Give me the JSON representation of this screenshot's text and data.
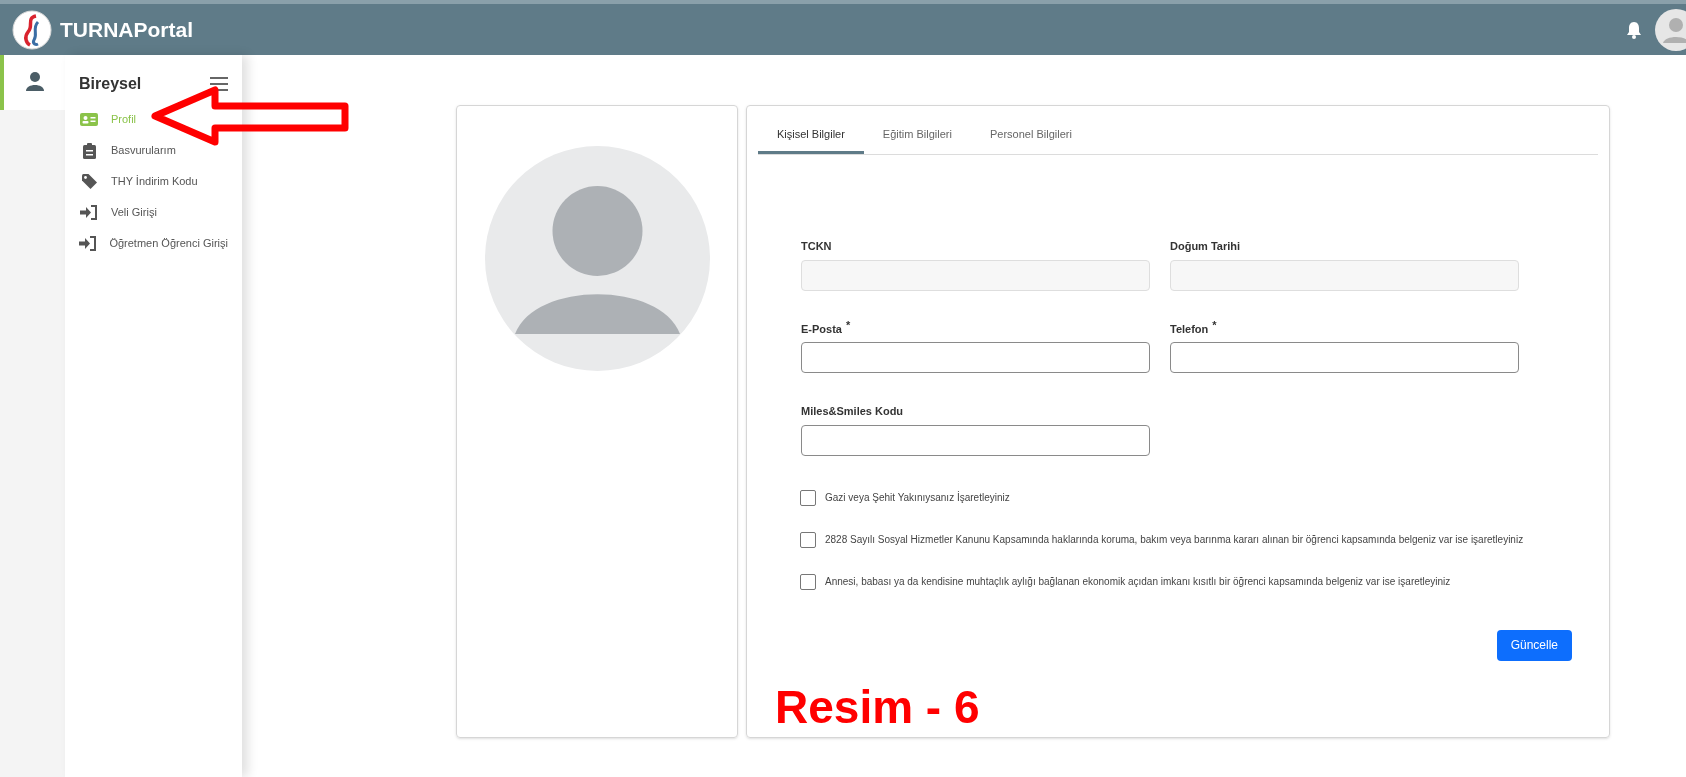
{
  "header": {
    "brand": "TURNAPortal"
  },
  "sidebar": {
    "section": "Bireysel",
    "items": [
      {
        "label": "Profil",
        "kind": "idcard",
        "selected": true
      },
      {
        "label": "Basvurularım",
        "kind": "clipboard",
        "selected": false
      },
      {
        "label": "THY İndirim Kodu",
        "kind": "tag",
        "selected": false
      },
      {
        "label": "Veli Girişi",
        "kind": "login",
        "selected": false
      },
      {
        "label": "Öğretmen Öğrenci Girişi",
        "kind": "login",
        "selected": false
      }
    ]
  },
  "tabs": [
    {
      "label": "Kişisel Bilgiler",
      "selected": true
    },
    {
      "label": "Eğitim Bilgileri",
      "selected": false
    },
    {
      "label": "Personel Bilgileri",
      "selected": false
    }
  ],
  "fields": [
    {
      "label": "TCKN",
      "disabled": true
    },
    {
      "label": "Doğum Tarihi",
      "disabled": true
    },
    {
      "label": "E-Posta",
      "disabled": false,
      "mark": "*"
    },
    {
      "label": "Telefon",
      "disabled": false,
      "mark": "*"
    },
    {
      "label": "Miles&Smiles Kodu",
      "disabled": false
    }
  ],
  "checkboxes": [
    {
      "label": "Gazi veya Şehit Yakınıysanız İşaretleyiniz",
      "checked": false
    },
    {
      "label": "2828 Sayılı Sosyal Hizmetler Kanunu Kapsamında haklarında koruma, bakım veya barınma kararı alınan bir öğrenci kapsamında belgeniz var ise işaretleyiniz",
      "checked": false
    },
    {
      "label": "Annesi, babası ya da kendisine muhtaçlık aylığı bağlanan ekonomik açıdan imkanı kısıtlı bir öğrenci kapsamında belgeniz var ise işaretleyiniz",
      "checked": false
    }
  ],
  "submit": "Güncelle",
  "annotation": {
    "caption": "Resim - 6"
  }
}
